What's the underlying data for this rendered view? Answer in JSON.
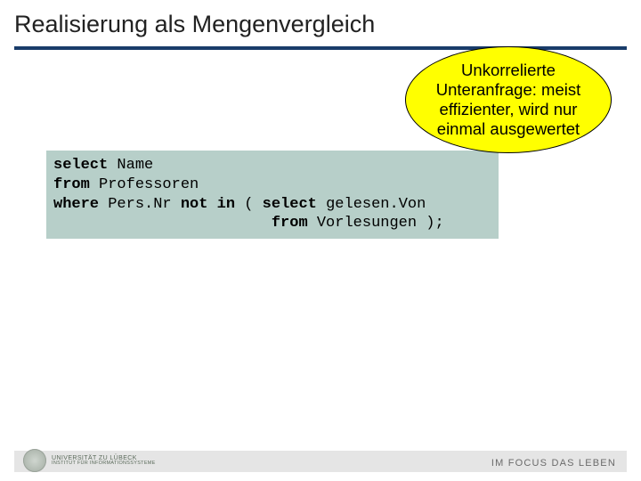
{
  "title": "Realisierung als Mengenvergleich",
  "code": {
    "line1_kw": "select",
    "line1_rest": " Name",
    "line2_kw": "from",
    "line2_rest": " Professoren",
    "line3_kw1": "where",
    "line3_mid": " Pers.Nr ",
    "line3_kw2": "not in",
    "line3_rest": " ( ",
    "line3_kw3": "select",
    "line3_tail": " gelesen.Von",
    "line4_pad": "                        ",
    "line4_kw": "from",
    "line4_rest": " Vorlesungen );"
  },
  "callout": {
    "text": "Unkorrelierte Unteranfrage: meist effizienter, wird nur einmal ausgewertet"
  },
  "footer": {
    "right": "IM FOCUS DAS LEBEN",
    "uni_line1": "UNIVERSITÄT ZU LÜBECK",
    "uni_line2": "INSTITUT FÜR INFORMATIONSSYSTEME"
  }
}
